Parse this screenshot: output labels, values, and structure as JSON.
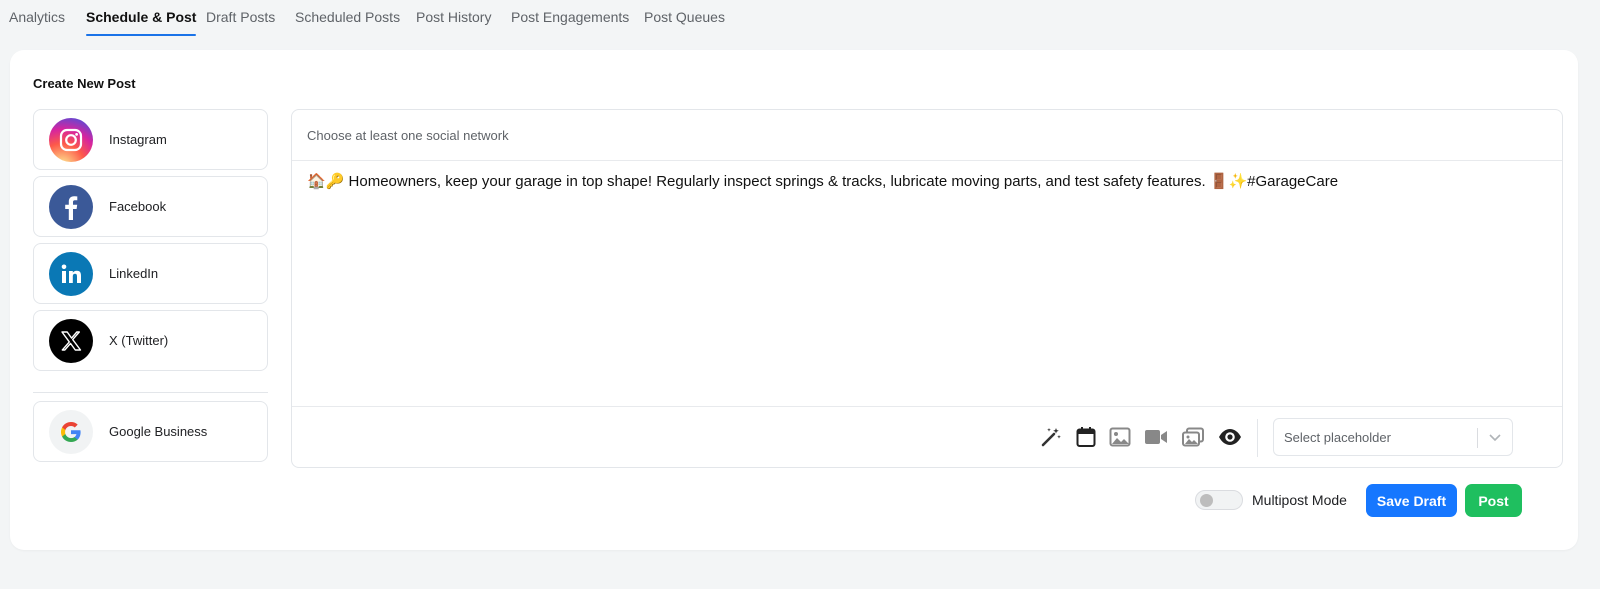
{
  "tabs": [
    {
      "label": "Analytics"
    },
    {
      "label": "Schedule & Post"
    },
    {
      "label": "Draft Posts"
    },
    {
      "label": "Scheduled Posts"
    },
    {
      "label": "Post History"
    },
    {
      "label": "Post Engagements"
    },
    {
      "label": "Post Queues"
    }
  ],
  "active_tab": "Schedule & Post",
  "card": {
    "title": "Create New Post"
  },
  "networks": [
    {
      "label": "Instagram",
      "icon": "instagram-icon"
    },
    {
      "label": "Facebook",
      "icon": "facebook-icon"
    },
    {
      "label": "LinkedIn",
      "icon": "linkedin-icon"
    },
    {
      "label": "X (Twitter)",
      "icon": "x-twitter-icon"
    },
    {
      "label": "Google Business",
      "icon": "google-icon"
    }
  ],
  "editor": {
    "header": "Choose at least one social network",
    "content": "🏠🔑 Homeowners, keep your garage in top shape! Regularly inspect springs & tracks, lubricate moving parts, and test safety features. 🚪✨#GarageCare",
    "placeholder_select": "Select placeholder"
  },
  "toolbar": {
    "icons": [
      "magic-wand-icon",
      "calendar-icon",
      "image-icon",
      "video-icon",
      "gallery-icon",
      "preview-eye-icon"
    ]
  },
  "actions": {
    "multipost_label": "Multipost Mode",
    "save_draft": "Save Draft",
    "post": "Post"
  },
  "colors": {
    "accent": "#1677ff",
    "post": "#1fbf5f",
    "active_tab_underline": "#1a73e8"
  }
}
